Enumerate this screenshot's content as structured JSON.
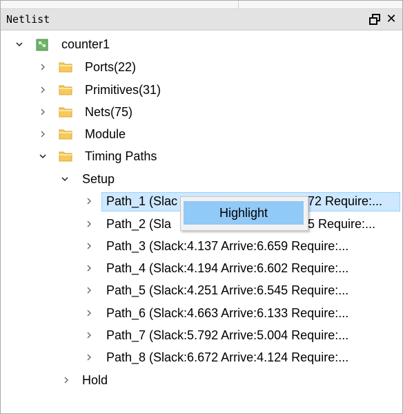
{
  "panel": {
    "title": "Netlist",
    "float_icon": "float-window-icon",
    "close_glyph": "✕",
    "close_icon": "close-icon"
  },
  "tree": {
    "root": {
      "label": "counter1",
      "expanded": true,
      "icon": "design-icon"
    },
    "folders": [
      {
        "label": "Ports(22)",
        "expanded": false,
        "icon": "folder-icon"
      },
      {
        "label": "Primitives(31)",
        "expanded": false,
        "icon": "folder-icon"
      },
      {
        "label": "Nets(75)",
        "expanded": false,
        "icon": "folder-icon"
      },
      {
        "label": "Module",
        "expanded": false,
        "icon": "folder-icon"
      },
      {
        "label": "Timing Paths",
        "expanded": true,
        "icon": "folder-icon"
      }
    ],
    "setup": {
      "label": "Setup",
      "expanded": true
    },
    "paths": [
      {
        "label": "Path_1 (Slack:0.824 Arrive:6.972 Require:...",
        "visible_prefix": "Path_1 (Slac",
        "visible_suffix": "72 Require:...",
        "selected": true
      },
      {
        "label": "Path_2 (Sla",
        "visible_suffix": "5 Require:..."
      },
      {
        "label": "Path_3 (Slack:4.137 Arrive:6.659 Require:..."
      },
      {
        "label": "Path_4 (Slack:4.194 Arrive:6.602 Require:..."
      },
      {
        "label": "Path_5 (Slack:4.251 Arrive:6.545 Require:..."
      },
      {
        "label": "Path_6 (Slack:4.663 Arrive:6.133 Require:..."
      },
      {
        "label": "Path_7 (Slack:5.792 Arrive:5.004 Require:..."
      },
      {
        "label": "Path_8 (Slack:6.672 Arrive:4.124 Require:..."
      }
    ],
    "hold": {
      "label": "Hold",
      "expanded": false
    }
  },
  "context_menu": {
    "items": [
      {
        "label": "Highlight",
        "hovered": true
      }
    ]
  },
  "colors": {
    "title_bg": "#e3e3e3",
    "selection_bg": "#cde8ff",
    "menu_hover": "#91c9f7",
    "folder_yellow": "#f8c95a"
  }
}
